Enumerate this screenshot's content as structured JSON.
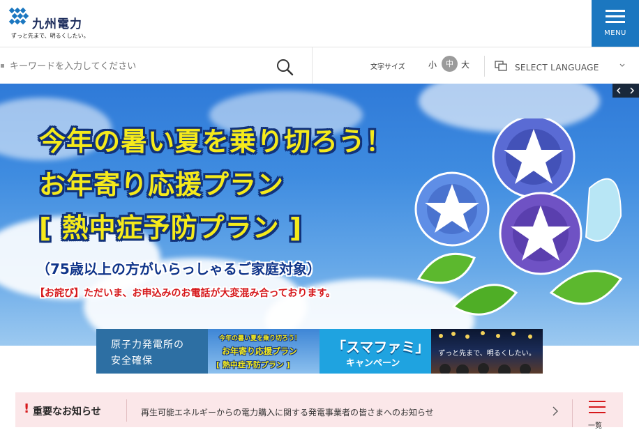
{
  "header": {
    "logo_name": "九州電力",
    "logo_tagline": "ずっと先まで、明るくしたい。",
    "menu_label": "MENU"
  },
  "toolbar": {
    "search_placeholder": "キーワードを入力してください",
    "font_size_label": "文字サイズ",
    "font_small": "小",
    "font_medium": "中",
    "font_large": "大",
    "language_label": "SELECT LANGUAGE"
  },
  "hero": {
    "line1": "今年の暑い夏を乗り切ろう！",
    "line2": "お年寄り応援プラン",
    "line3": "[ 熱中症予防プラン ]",
    "subtitle": "（75歳以上の方がいらっしゃるご家庭対象）",
    "apology": "【お詫び】ただいま、お申込みのお電話が大変混み合っております。"
  },
  "thumbnails": {
    "t1_line1": "原子力発電所の",
    "t1_line2": "安全確保",
    "t2_line1": "今年の暑い夏を乗り切ろう！",
    "t2_line2": "お年寄り応援プラン",
    "t2_line3": "[ 熱中症予防プラン ]",
    "t3_title": "「スマファミ」",
    "t3_sub": "キャンペーン",
    "t4_text": "ずっと先まで、明るくしたい。"
  },
  "notice": {
    "title": "重要なお知らせ",
    "link_text": "再生可能エネルギーからの電力購入に関する発電事業者の皆さまへのお知らせ",
    "list_label": "一覧"
  },
  "colors": {
    "brand_blue": "#1b77c0",
    "hero_yellow": "#f5ea1b",
    "alert_red": "#d6181b",
    "notice_bg": "#fbe7e9"
  }
}
